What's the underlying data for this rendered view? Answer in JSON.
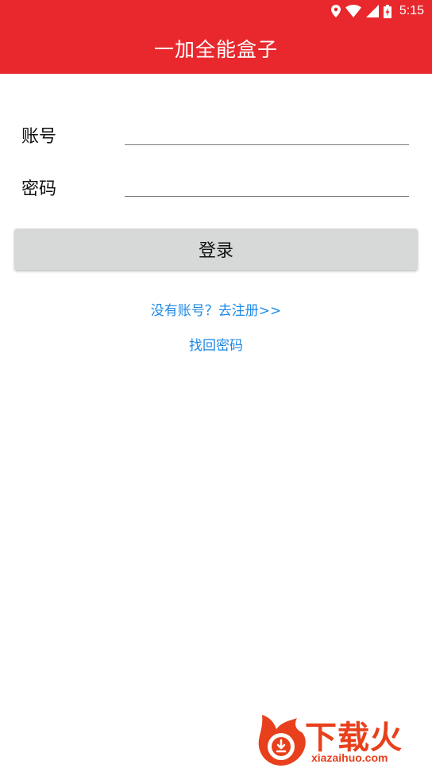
{
  "status_bar": {
    "time": "5:15",
    "icons": [
      "location-icon",
      "wifi-icon",
      "signal-icon",
      "battery-charging-icon"
    ]
  },
  "app_bar": {
    "title": "一加全能盒子"
  },
  "form": {
    "account_label": "账号",
    "account_value": "",
    "password_label": "密码",
    "password_value": ""
  },
  "login_button": {
    "label": "登录"
  },
  "links": {
    "register": "没有账号？去注册>>",
    "forgot_password": "找回密码"
  },
  "watermark": {
    "brand_text": "下载火",
    "url": "xiazaihuo.com"
  },
  "colors": {
    "primary": "#e8282d",
    "link": "#1e88e5",
    "button_bg": "#d7d8d8",
    "watermark": "#e8401c"
  }
}
